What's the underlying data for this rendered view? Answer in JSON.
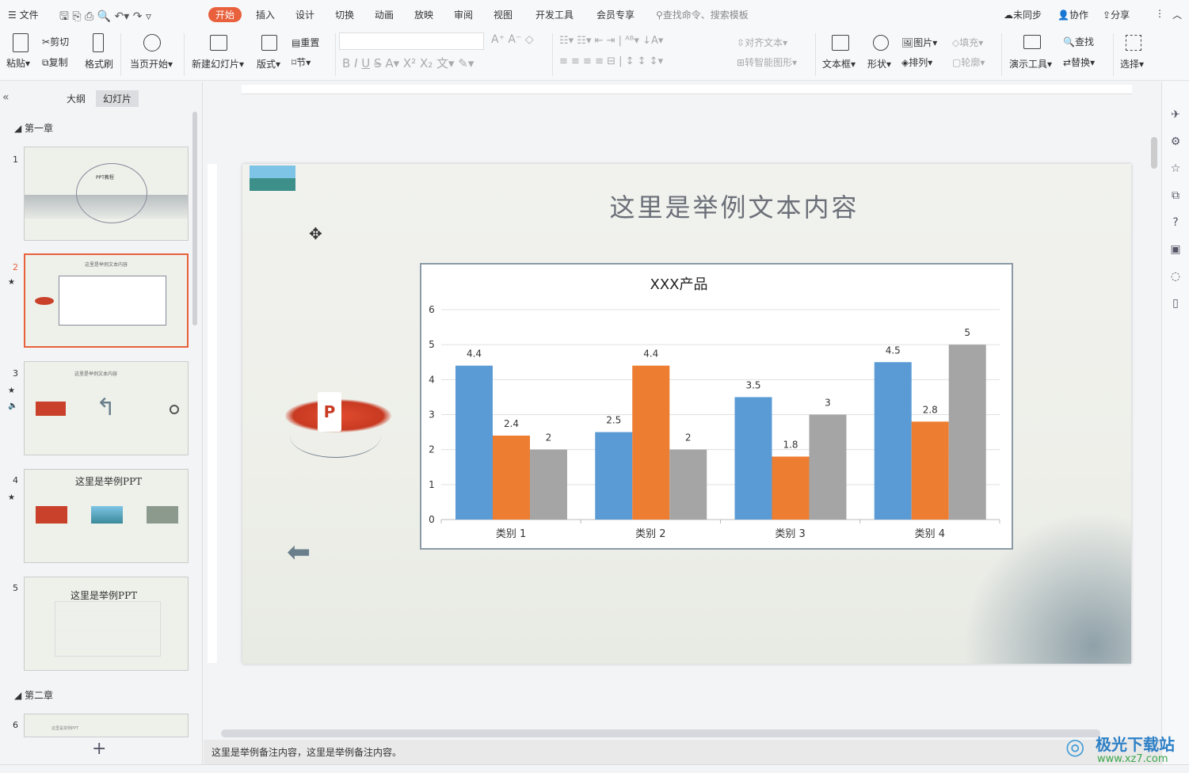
{
  "menu": {
    "file": "文件",
    "tabs": [
      "开始",
      "插入",
      "设计",
      "切换",
      "动画",
      "放映",
      "审阅",
      "视图",
      "开发工具",
      "会员专享"
    ],
    "search": "查找命令、搜索模板",
    "sync": "未同步",
    "collab": "协作",
    "share": "分享"
  },
  "ribbon": {
    "paste": "粘贴",
    "cut": "剪切",
    "copy": "复制",
    "format_painter": "格式刷",
    "play_from_current": "当页开始",
    "new_slide": "新建幻灯片",
    "layout": "版式",
    "reset": "重置",
    "section": "节",
    "align_text": "对齐文本",
    "smart_art": "转智能图形",
    "textbox": "文本框",
    "shape": "形状",
    "picture": "图片",
    "fill": "填充",
    "arrange": "排列",
    "outline": "轮廓",
    "presenter_tools": "演示工具",
    "find": "查找",
    "replace": "替换",
    "select": "选择"
  },
  "sidebar": {
    "tab_outline": "大纲",
    "tab_slides": "幻灯片",
    "section1": "第一章",
    "section2": "第二章",
    "slides": [
      {
        "num": "1",
        "title": "PPT教程"
      },
      {
        "num": "2",
        "title": "这里是举例文本内容"
      },
      {
        "num": "3",
        "title": "这里是举例文本内容"
      },
      {
        "num": "4",
        "title": "这里是举例PPT"
      },
      {
        "num": "5",
        "title": "这里是举例PPT"
      },
      {
        "num": "6",
        "title": "这里是举例PPT"
      }
    ]
  },
  "slide": {
    "title": "这里是举例文本内容"
  },
  "notes": "这里是举例备注内容，这里是举例备注内容。",
  "watermark": {
    "name": "极光下载站",
    "url": "www.xz7.com"
  },
  "colors": {
    "accent": "#e8603c",
    "series": [
      "#5b9bd5",
      "#ed7d31",
      "#a5a5a5"
    ]
  },
  "chart_data": {
    "type": "bar",
    "title": "XXX产品",
    "categories": [
      "类别 1",
      "类别 2",
      "类别 3",
      "类别 4"
    ],
    "series": [
      {
        "values": [
          4.4,
          2.5,
          3.5,
          4.5
        ]
      },
      {
        "values": [
          2.4,
          4.4,
          1.8,
          2.8
        ]
      },
      {
        "values": [
          2,
          2,
          3,
          5
        ]
      }
    ],
    "ylim": [
      0,
      6
    ],
    "yticks": [
      0,
      1,
      2,
      3,
      4,
      5,
      6
    ],
    "grid": true,
    "data_labels": true
  }
}
